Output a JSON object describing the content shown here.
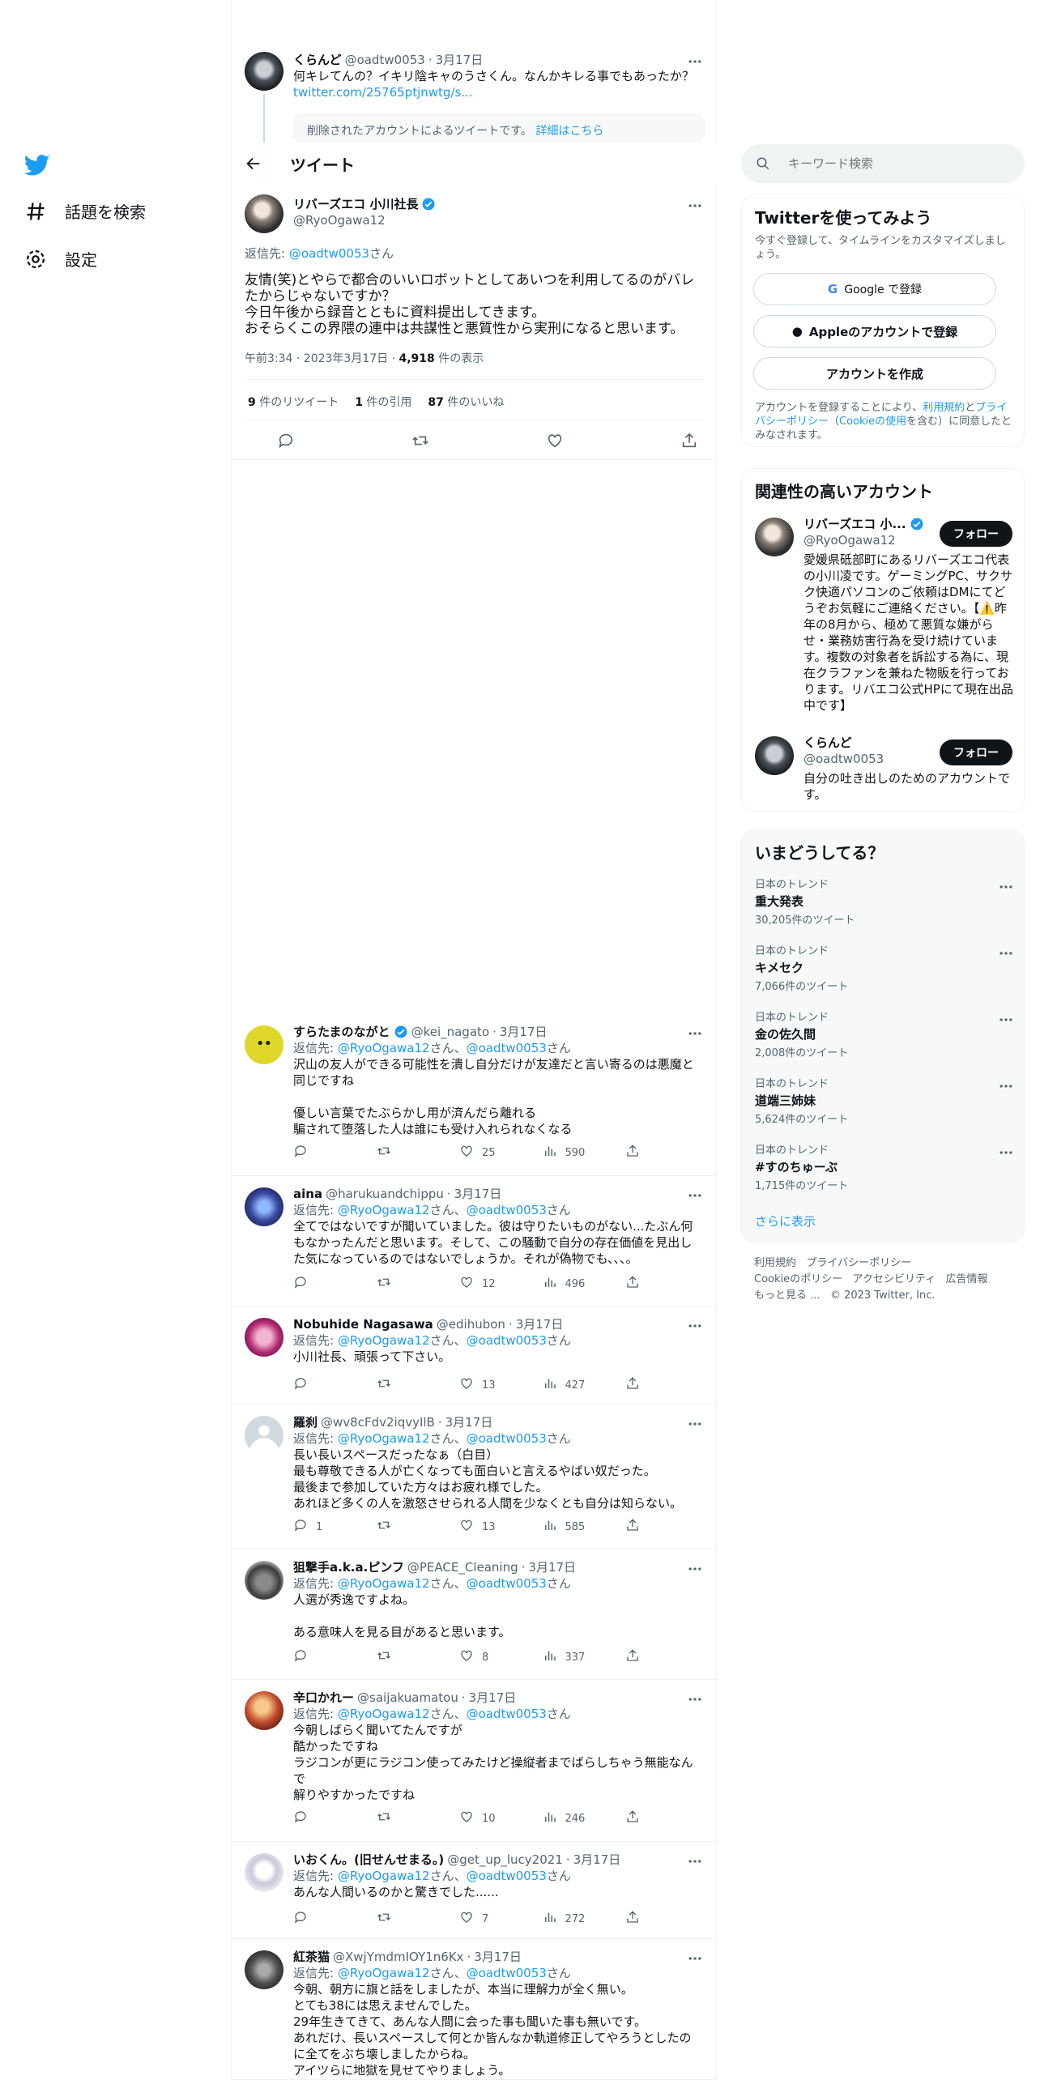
{
  "nav": {
    "explore": "話題を検索",
    "settings": "設定"
  },
  "top_tweet": {
    "name": "くらんど",
    "handle": "@oadtw0053",
    "date": "3月17日",
    "text": "何キレてんの？イキリ陰キャのうさくん。なんかキレる事でもあったか？",
    "link": "twitter.com/25765ptjnwtg/s...",
    "deleted_notice": "削除されたアカウントによるツイートです。",
    "deleted_link": "詳細はこちら"
  },
  "header": {
    "title": "ツイート"
  },
  "main_tweet": {
    "name": "リバーズエコ 小川社長",
    "handle": "@RyoOgawa12",
    "reply_prefix": "返信先: ",
    "reply_to": "@oadtw0053",
    "reply_suffix": "さん",
    "text": "友情(笑)とやらで都合のいいロボットとしてあいつを利用してるのがバレたからじゃないですか？\n今日午後から録音とともに資料提出してきます。\nおそらくこの界隈の連中は共謀性と悪質性から実刑になると思います。",
    "time": "午前3:34 · 2023年3月17日 · ",
    "views": "4,918",
    "views_label": " 件の表示",
    "retweets": "9",
    "retweets_label": " 件のリツイート",
    "quotes": "1",
    "quotes_label": " 件の引用",
    "likes": "87",
    "likes_label": " 件のいいね"
  },
  "replies": [
    {
      "name": "すらたまのながと",
      "verified": true,
      "handle": "@kei_nagato",
      "date": "3月17日",
      "text": "沢山の友人ができる可能性を潰し自分だけが友達だと言い寄るのは悪魔と同じですね\n\n優しい言葉でたぶらかし用が済んだら離れる\n騙されて堕落した人は誰にも受け入れられなくなる",
      "replies": "",
      "retweets": "",
      "likes": "25",
      "views": "590"
    },
    {
      "name": "aina",
      "verified": false,
      "handle": "@harukuandchippu",
      "date": "3月17日",
      "text": "全てではないですが聞いていました。彼は守りたいものがない...たぶん何もなかったんだと思います。そして、この騒動で自分の存在価値を見出した気になっているのではないでしょうか。それが偽物でも、、、。",
      "replies": "",
      "retweets": "",
      "likes": "12",
      "views": "496"
    },
    {
      "name": "Nobuhide Nagasawa",
      "verified": false,
      "handle": "@edihubon",
      "date": "3月17日",
      "text": "小川社長、頑張って下さい。",
      "replies": "",
      "retweets": "",
      "likes": "13",
      "views": "427"
    },
    {
      "name": "羅刹",
      "verified": false,
      "handle": "@wv8cFdv2iqvyIlB",
      "date": "3月17日",
      "text": "長い長いスペースだったなぁ（白目）\n最も尊敬できる人が亡くなっても面白いと言えるやばい奴だった。\n最後まで参加していた方々はお疲れ様でした。\nあれほど多くの人を激怒させられる人間を少なくとも自分は知らない。",
      "replies": "1",
      "retweets": "",
      "likes": "13",
      "views": "585"
    },
    {
      "name": "狙撃手a.k.a.ピンフ",
      "verified": false,
      "handle": "@PEACE_Cleaning",
      "date": "3月17日",
      "text": "人選が秀逸ですよね。\n\nある意味人を見る目があると思います。",
      "replies": "",
      "retweets": "",
      "likes": "8",
      "views": "337"
    },
    {
      "name": "辛口かれー",
      "verified": false,
      "handle": "@saijakuamatou",
      "date": "3月17日",
      "text": "今朝しばらく聞いてたんですが\n酷かったですね\nラジコンが更にラジコン使ってみたけど操縦者までばらしちゃう無能なんで\n解りやすかったですね",
      "replies": "",
      "retweets": "",
      "likes": "10",
      "views": "246"
    },
    {
      "name": "いおくん。(旧せんせまる。)",
      "verified": false,
      "handle": "@get_up_lucy2021",
      "date": "3月17日",
      "text": "あんな人間いるのかと驚きでした......",
      "replies": "",
      "retweets": "",
      "likes": "7",
      "views": "272"
    },
    {
      "name": "紅茶猫",
      "verified": false,
      "handle": "@XwjYmdmIOY1n6Kx",
      "date": "3月17日",
      "text": "今朝、朝方に旗と話をしましたが、本当に理解力が全く無い。\nとても38には思えませんでした。\n29年生きてきて、あんな人間に会った事も聞いた事も無いです。\nあれだけ、長いスペースして何とか皆んなか軌道修正してやろうとしたのに全てをぶち壊しましたからね。\nアイツらに地獄を見せてやりましょう。",
      "replies": "",
      "retweets": "",
      "likes": "",
      "views": ""
    }
  ],
  "reply_labels": {
    "prefix": "返信先: ",
    "user1": "@RyoOgawa12",
    "mid": "さん、",
    "user2": "@oadtw0053",
    "suffix": "さん"
  },
  "search": {
    "placeholder": "キーワード検索"
  },
  "signup": {
    "title": "Twitterを使ってみよう",
    "subtitle": "今すぐ登録して、タイムラインをカスタマイズしましょう。",
    "google": "Google で登録",
    "apple": "Appleのアカウントで登録",
    "create": "アカウントを作成",
    "terms_1": "アカウントを登録することにより、",
    "terms_link1": "利用規約",
    "terms_2": "と",
    "terms_link2": "プライバシーポリシー",
    "terms_3": "（",
    "terms_link3": "Cookieの使用",
    "terms_4": "を含む）に同意したとみなされます。"
  },
  "related": {
    "title": "関連性の高いアカウント",
    "follow_label": "フォロー",
    "accounts": [
      {
        "name": "リバーズエコ 小...",
        "handle": "@RyoOgawa12",
        "bio": "愛媛県砥部町にあるリバーズエコ代表の小川凌です。ゲーミングPC、サクサク快適パソコンのご依頼はDMにてどうぞお気軽にご連絡ください。【⚠️昨年の8月から、極めて悪質な嫌がらせ・業務妨害行為を受け続けています。複数の対象者を訴訟する為に、現在クラファンを兼ねた物販を行っております。リバエコ公式HPにて現在出品中です】"
      },
      {
        "name": "くらんど",
        "handle": "@oadtw0053",
        "bio": "自分の吐き出しのためのアカウントです。"
      }
    ]
  },
  "trends": {
    "title": "いまどうしてる？",
    "items": [
      {
        "category": "日本のトレンド",
        "name": "重大発表",
        "count": "30,205件のツイート"
      },
      {
        "category": "日本のトレンド",
        "name": "キメセク",
        "count": "7,066件のツイート"
      },
      {
        "category": "日本のトレンド",
        "name": "金の佐久間",
        "count": "2,008件のツイート"
      },
      {
        "category": "日本のトレンド",
        "name": "道端三姉妹",
        "count": "5,624件のツイート"
      },
      {
        "category": "日本のトレンド",
        "name": "#すのちゅーぶ",
        "count": "1,715件のツイート"
      }
    ],
    "show_more": "さらに表示"
  },
  "footer": {
    "links": [
      "利用規約",
      "プライバシーポリシー",
      "Cookieのポリシー",
      "アクセシビリティ",
      "広告情報",
      "もっと見る ..."
    ],
    "copyright": "© 2023 Twitter, Inc."
  },
  "colors": {
    "accent": "#1d9bf0",
    "text": "#0f1419",
    "muted": "#536471"
  }
}
